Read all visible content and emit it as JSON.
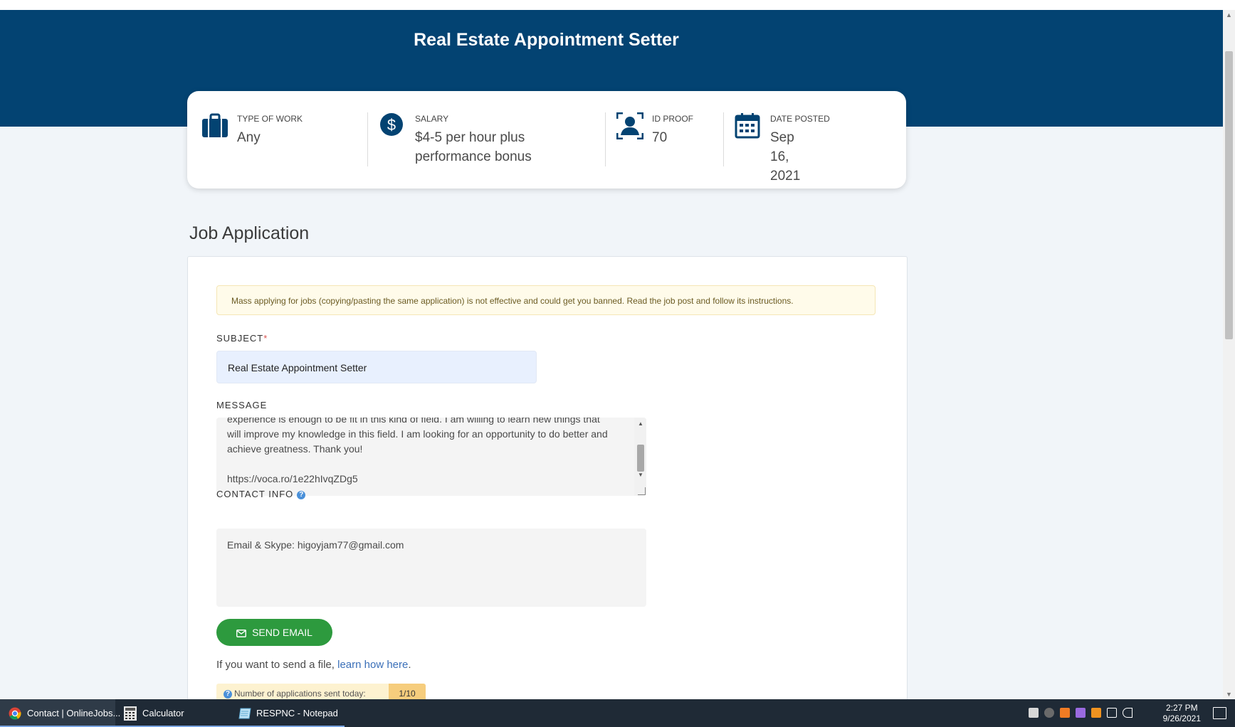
{
  "page": {
    "title": "Real Estate Appointment Setter"
  },
  "info_card": {
    "items": [
      {
        "label": "TYPE OF WORK",
        "value": "Any",
        "icon": "briefcase-icon"
      },
      {
        "label": "SALARY",
        "value": "$4-5 per hour plus performance bonus",
        "icon": "dollar-icon"
      },
      {
        "label": "ID PROOF",
        "value": "70",
        "icon": "id-proof-icon"
      },
      {
        "label": "DATE POSTED",
        "value": "Sep 16, 2021",
        "icon": "calendar-icon"
      }
    ]
  },
  "form": {
    "section_title": "Job Application",
    "warning": "Mass applying for jobs (copying/pasting the same application) is not effective and could get you banned. Read the job post and follow its instructions.",
    "subject_label": "SUBJECT",
    "subject_required": "*",
    "subject_value": "Real Estate Appointment Setter",
    "message_label": "MESSAGE",
    "message_lines": [
      "experience is enough to be fit in this kind of field. I am willing to learn new things that",
      "will improve my knowledge in this field. I am looking for an opportunity to do better and",
      "achieve greatness. Thank you!",
      "",
      "https://voca.ro/1e22hIvqZDg5"
    ],
    "contact_label": "CONTACT INFO",
    "contact_value": "Email & Skype: higoyjam77@gmail.com",
    "send_label": "SEND EMAIL",
    "file_hint_prefix": "If you want to send a file, ",
    "file_hint_link": "learn how here",
    "file_hint_suffix": ".",
    "apps_label": "Number of applications sent today:",
    "apps_count": "1/10"
  },
  "taskbar": {
    "items": [
      {
        "label": "Contact | OnlineJobs..."
      },
      {
        "label": "Calculator"
      },
      {
        "label": "RESPNC - Notepad"
      }
    ],
    "time": "2:27 PM",
    "date": "9/26/2021"
  },
  "colors": {
    "header": "#034372",
    "accent_green": "#2d9a3e",
    "link": "#3a6fb8"
  }
}
